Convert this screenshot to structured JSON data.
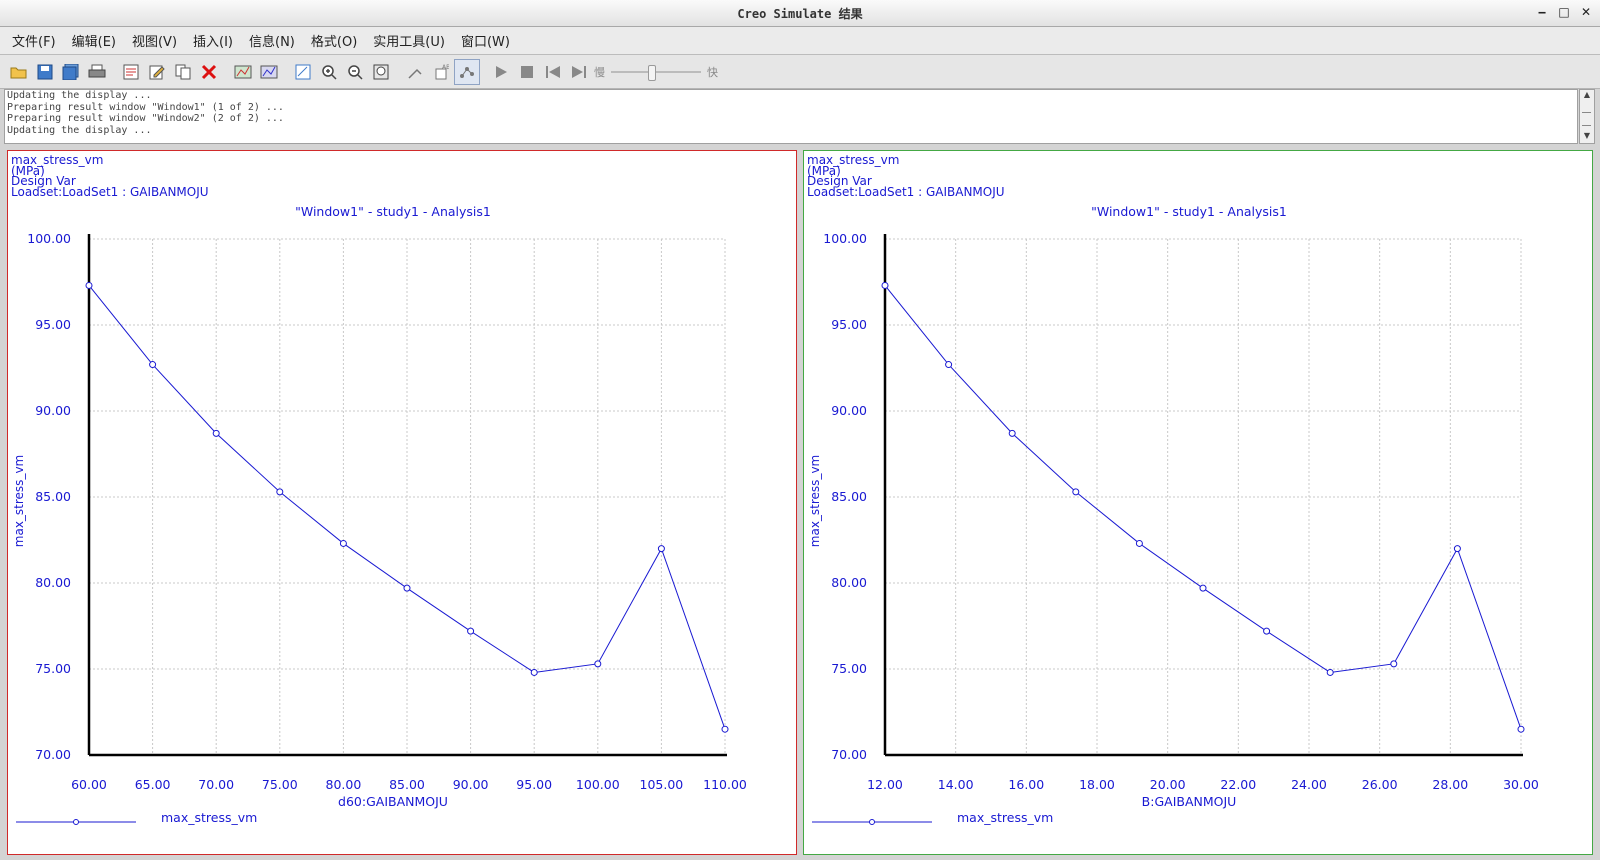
{
  "window": {
    "title": "Creo Simulate 结果",
    "min": "‒",
    "max": "□",
    "close": "✕"
  },
  "menu": [
    "文件(F)",
    "编辑(E)",
    "视图(V)",
    "插入(I)",
    "信息(N)",
    "格式(O)",
    "实用工具(U)",
    "窗口(W)"
  ],
  "toolbar": {
    "icons": [
      "open-icon",
      "save-icon",
      "save-all-icon",
      "print-icon",
      "sep",
      "edit-definition-icon",
      "edit-icon",
      "copy-icon",
      "delete-icon",
      "sep",
      "show-results-icon",
      "hide-results-icon",
      "sep",
      "view-model-icon",
      "zoom-in-icon",
      "zoom-out-icon",
      "refit-icon",
      "sep",
      "spin-icon",
      "info-icon",
      "graph-icon",
      "sep",
      "play-icon",
      "stop-icon",
      "first-frame-icon",
      "last-frame-icon"
    ],
    "slow_label": "慢",
    "fast_label": "快",
    "speed_fraction": 0.44
  },
  "log": [
    "Updating the display ...",
    "Preparing result window \"Window1\" (1 of 2) ...",
    "Preparing result window \"Window2\" (2 of 2) ...",
    "Updating the display ..."
  ],
  "panels": [
    {
      "header": [
        "max_stress_vm",
        "(MPa)",
        "Design Var",
        "Loadset:LoadSet1 :  GAIBANMOJU"
      ]
    },
    {
      "header": [
        "max_stress_vm",
        "(MPa)",
        "Design Var",
        "Loadset:LoadSet1 :  GAIBANMOJU"
      ]
    }
  ],
  "colors": {
    "plot": "#1919d2",
    "grid": "#c8c8c8",
    "left_border": "#d02a2a",
    "right_border": "#44a844"
  },
  "chart_data": [
    {
      "type": "line",
      "title": "\"Window1\" - study1 - Analysis1",
      "xlabel": "d60:GAIBANMOJU",
      "ylabel": "max_stress_vm",
      "legend": "max_stress_vm",
      "legend_position": "bottom-left",
      "grid": true,
      "xlim": [
        60,
        110
      ],
      "ylim": [
        70,
        100
      ],
      "xticks": [
        "60.00",
        "65.00",
        "70.00",
        "75.00",
        "80.00",
        "85.00",
        "90.00",
        "95.00",
        "100.00",
        "105.00",
        "110.00"
      ],
      "yticks": [
        "70.00",
        "75.00",
        "80.00",
        "85.00",
        "90.00",
        "95.00",
        "100.00"
      ],
      "x": [
        60,
        65,
        70,
        75,
        80,
        85,
        90,
        95,
        100,
        105,
        110
      ],
      "y": [
        97.3,
        92.7,
        88.7,
        85.3,
        82.3,
        79.7,
        77.2,
        74.8,
        75.3,
        82.0,
        71.5
      ]
    },
    {
      "type": "line",
      "title": "\"Window1\" - study1 - Analysis1",
      "xlabel": "B:GAIBANMOJU",
      "ylabel": "max_stress_vm",
      "legend": "max_stress_vm",
      "legend_position": "bottom-left",
      "grid": true,
      "xlim": [
        12,
        30
      ],
      "ylim": [
        70,
        100
      ],
      "xticks": [
        "12.00",
        "14.00",
        "16.00",
        "18.00",
        "20.00",
        "22.00",
        "24.00",
        "26.00",
        "28.00",
        "30.00"
      ],
      "yticks": [
        "70.00",
        "75.00",
        "80.00",
        "85.00",
        "90.00",
        "95.00",
        "100.00"
      ],
      "x": [
        12,
        13.8,
        15.6,
        17.4,
        19.2,
        21,
        22.8,
        24.6,
        26.4,
        28.2,
        30
      ],
      "y": [
        97.3,
        92.7,
        88.7,
        85.3,
        82.3,
        79.7,
        77.2,
        74.8,
        75.3,
        82.0,
        71.5
      ]
    }
  ]
}
